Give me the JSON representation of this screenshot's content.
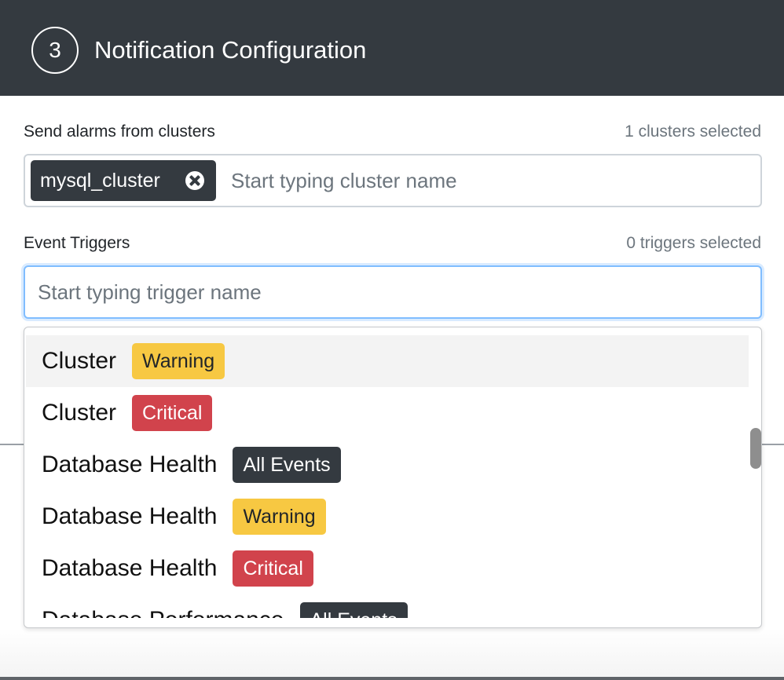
{
  "header": {
    "step_number": "3",
    "title": "Notification Configuration"
  },
  "clusters": {
    "label": "Send alarms from clusters",
    "count_text": "1 clusters selected",
    "chips": [
      {
        "label": "mysql_cluster"
      }
    ],
    "input_placeholder": "Start typing cluster name"
  },
  "triggers": {
    "label": "Event Triggers",
    "count_text": "0 triggers selected",
    "input_value": "",
    "input_placeholder": "Start typing trigger name"
  },
  "dropdown": {
    "options": [
      {
        "name": "Cluster",
        "badge": "Warning",
        "severity": "warning"
      },
      {
        "name": "Cluster",
        "badge": "Critical",
        "severity": "critical"
      },
      {
        "name": "Database Health",
        "badge": "All Events",
        "severity": "all"
      },
      {
        "name": "Database Health",
        "badge": "Warning",
        "severity": "warning"
      },
      {
        "name": "Database Health",
        "badge": "Critical",
        "severity": "critical"
      },
      {
        "name": "Database Performance",
        "badge": "All Events",
        "severity": "all"
      }
    ]
  },
  "colors": {
    "header_bg": "#343a40",
    "warning": "#f7c842",
    "critical": "#d1434c",
    "all_events": "#343a40",
    "focus_border": "#80bdff"
  }
}
